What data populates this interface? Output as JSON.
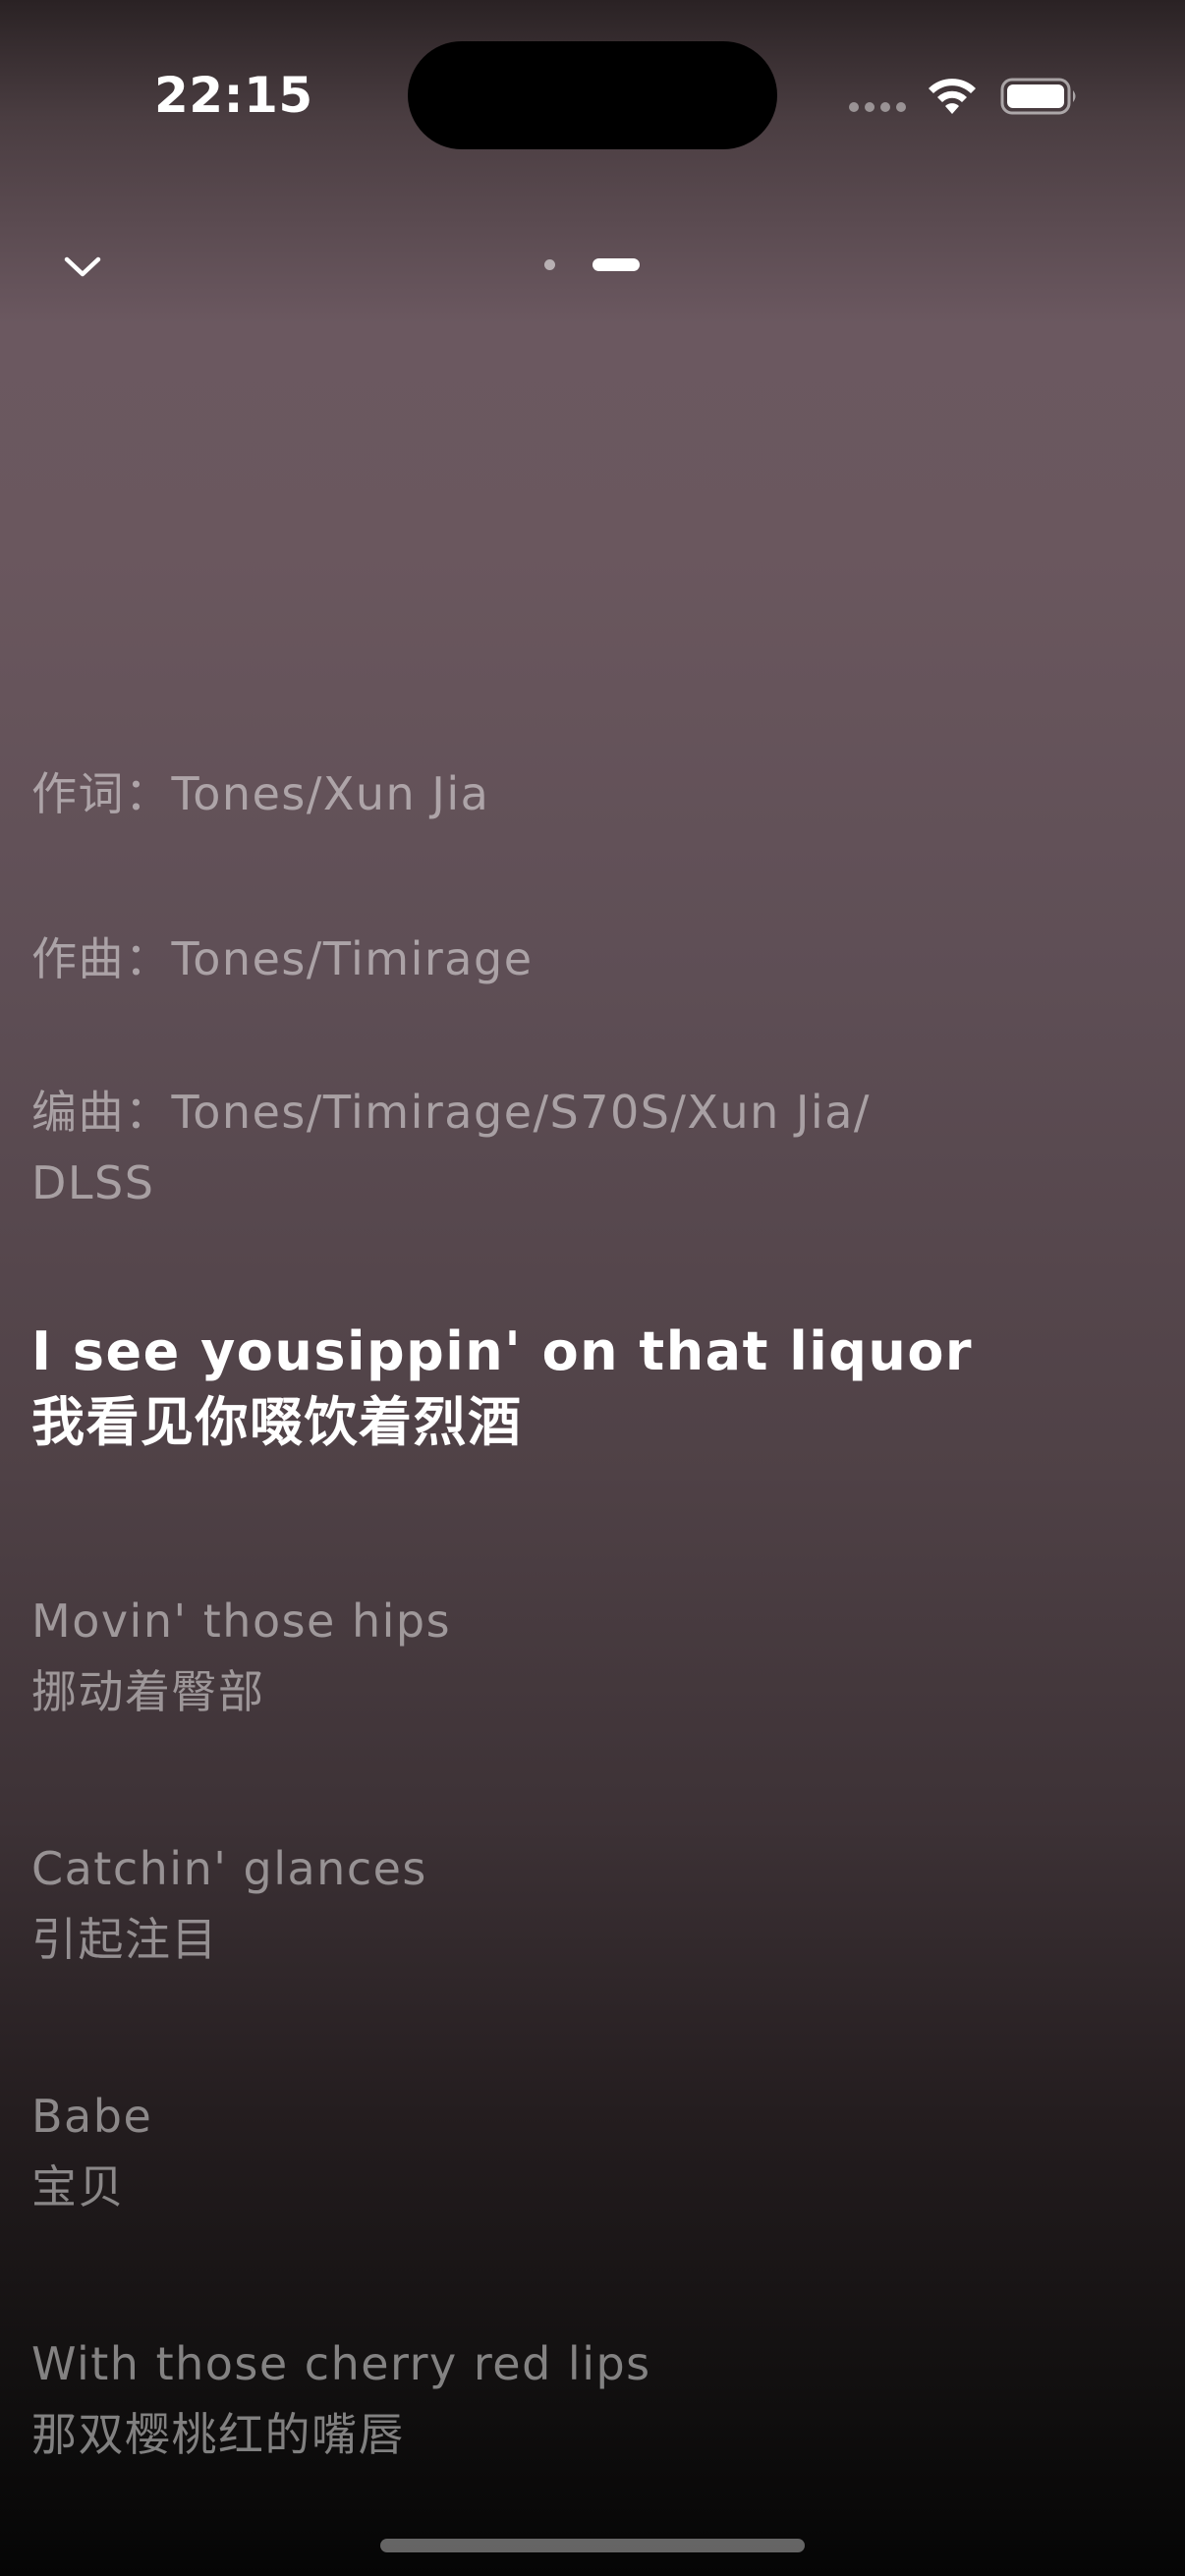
{
  "status_bar": {
    "time": "22:15",
    "icons": [
      "cellular-signal-icon",
      "wifi-icon",
      "battery-icon"
    ]
  },
  "top_controls": {
    "collapse_icon": "chevron-down-icon",
    "page_indicator": {
      "pages": 2,
      "current_page": 2
    }
  },
  "lyrics": {
    "credits": [
      {
        "text": "作词：Tones/Xun Jia"
      },
      {
        "text": "作曲：Tones/Timirage"
      },
      {
        "line1": "编曲：Tones/Timirage/S70S/Xun Jia/",
        "line2": "DLSS"
      }
    ],
    "active_line": {
      "original": "I see yousippin' on that liquor",
      "translation": "我看见你啜饮着烈酒"
    },
    "upcoming": [
      {
        "original": "Movin' those hips",
        "translation": "挪动着臀部"
      },
      {
        "original": "Catchin' glances",
        "translation": "引起注目"
      },
      {
        "original": "Babe",
        "translation": "宝贝"
      },
      {
        "original": "With those cherry red lips",
        "translation": "那双樱桃红的嘴唇"
      }
    ]
  },
  "colors": {
    "background_top": "#6b5860",
    "background_bottom": "#050505",
    "active_text": "#ffffff",
    "inactive_text": "rgba(255,255,255,0.48)"
  }
}
